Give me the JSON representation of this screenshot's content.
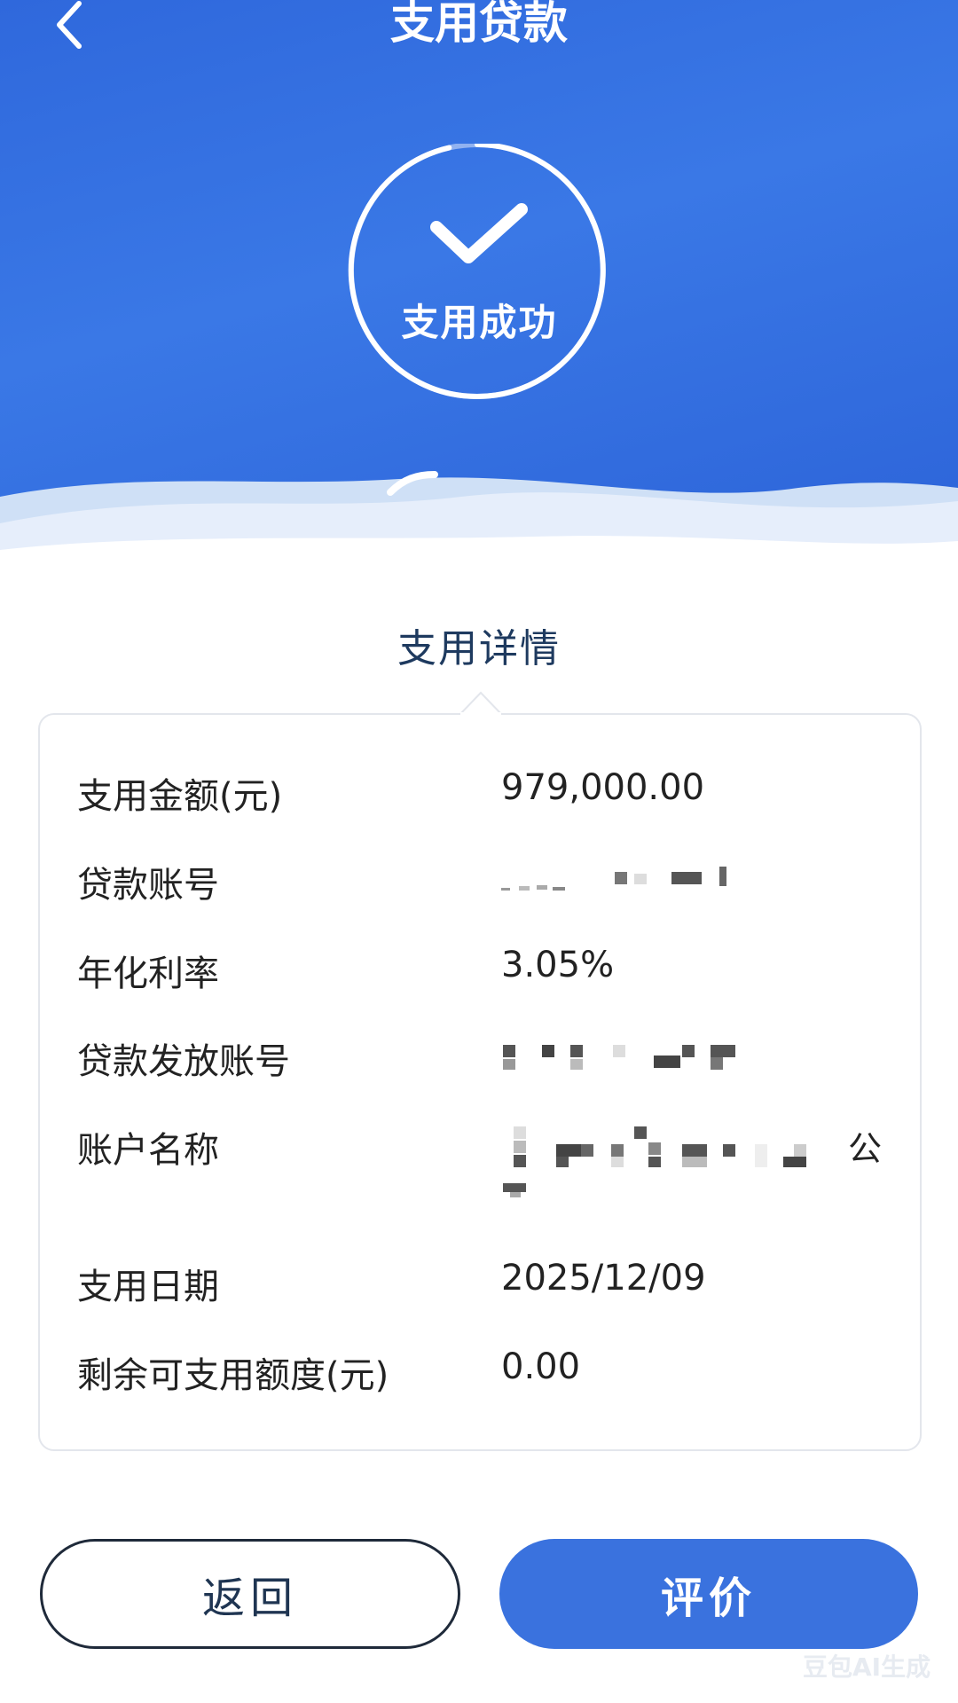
{
  "header": {
    "title": "支用贷款",
    "status_text": "支用成功",
    "color": "#3a78e6"
  },
  "section_title": "支用详情",
  "details": {
    "amount_label": "支用金额(元)",
    "amount_value": "979,000.00",
    "loan_account_label": "贷款账号",
    "rate_label": "年化利率",
    "rate_value": "3.05%",
    "disburse_account_label": "贷款发放账号",
    "account_name_label": "账户名称",
    "account_name_suffix": "公",
    "date_label": "支用日期",
    "date_value": "2025/12/09",
    "remaining_label": "剩余可支用额度(元)",
    "remaining_value": "0.00"
  },
  "buttons": {
    "back_label": "返回",
    "rate_label": "评价",
    "accent": "#3a72de"
  },
  "watermark": "豆包AI生成",
  "icons": [
    "back-arrow-icon",
    "checkmark-icon",
    "progress-ring-icon"
  ]
}
